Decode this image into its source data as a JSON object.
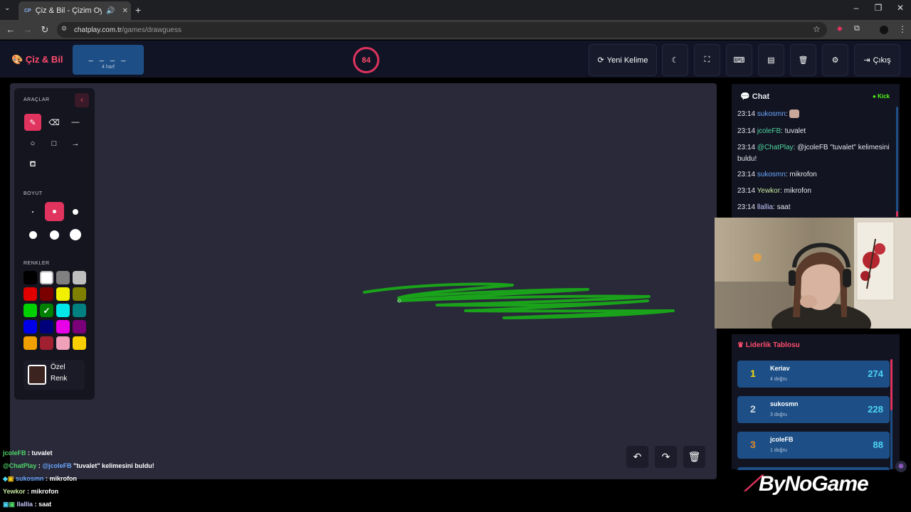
{
  "browser": {
    "tab_title": "Çiz & Bil - Çizim Oyunu",
    "tab_favicon": "CP",
    "url_host": "chatplay.com.tr",
    "url_path": "/games/drawguess"
  },
  "header": {
    "logo": "Çiz & Bil",
    "word_mask": "_ _ _ _",
    "word_hint": "4 harf",
    "timer": "84",
    "new_word_label": "Yeni Kelime",
    "exit_label": "Çıkış"
  },
  "tools": {
    "section_tools": "ARAÇLAR",
    "section_size": "BOYUT",
    "section_colors": "RENKLER",
    "custom_color_label_1": "Özel",
    "custom_color_label_2": "Renk",
    "palette": [
      "#000000",
      "#ffffff",
      "#808080",
      "#bfbfbf",
      "#e00000",
      "#7a0000",
      "#f0f000",
      "#808000",
      "#00d000",
      "#008000",
      "#00e8e8",
      "#008080",
      "#0000e8",
      "#00007a",
      "#e800e8",
      "#7a007a",
      "#f0a000",
      "#a02030",
      "#f0a0b8",
      "#f8d000"
    ],
    "selected_color": "#008000",
    "stroke_color": "#1aa31a",
    "custom_color": "#3b2320"
  },
  "chat": {
    "title": "Chat",
    "status": "Kick",
    "messages": [
      {
        "time": "23:14",
        "user": "sukosmn",
        "text": ""
      },
      {
        "time": "23:14",
        "user": "jcoleFB",
        "text": "tuvalet"
      },
      {
        "time": "23:14",
        "user": "@ChatPlay",
        "text": "@jcoleFB \"tuvalet\" kelimesini buldu!"
      },
      {
        "time": "23:14",
        "user": "sukosmn",
        "text": "mikrofon"
      },
      {
        "time": "23:14",
        "user": "Yewkor",
        "text": "mikrofon"
      },
      {
        "time": "23:14",
        "user": "llallia",
        "text": "saat"
      }
    ]
  },
  "leaderboard": {
    "title": "Liderlik Tablosu",
    "rows": [
      {
        "rank": "1",
        "name": "Keriav",
        "correct": "4 doğru",
        "score": "274",
        "rank_color": "#f5d90a"
      },
      {
        "rank": "2",
        "name": "sukosmn",
        "correct": "3 doğru",
        "score": "228",
        "rank_color": "#d0d6e0"
      },
      {
        "rank": "3",
        "name": "jcoleFB",
        "correct": "1 doğru",
        "score": "88",
        "rank_color": "#e08a2c"
      }
    ]
  },
  "overlay_chat": [
    {
      "user": "jcoleFB",
      "sep": ":",
      "text": "tuvalet"
    },
    {
      "user": "@ChatPlay",
      "sep": ":",
      "mention": "@jcoleFB",
      "text": "\"tuvalet\" kelimesini buldu!"
    },
    {
      "user": "sukosmn",
      "sep": ":",
      "text": "mikrofon"
    },
    {
      "user": "Yewkor",
      "sep": ":",
      "text": "mikrofon"
    },
    {
      "user": "llallia",
      "sep": ":",
      "text": "saat"
    }
  ],
  "watermark": "ByNoGame"
}
